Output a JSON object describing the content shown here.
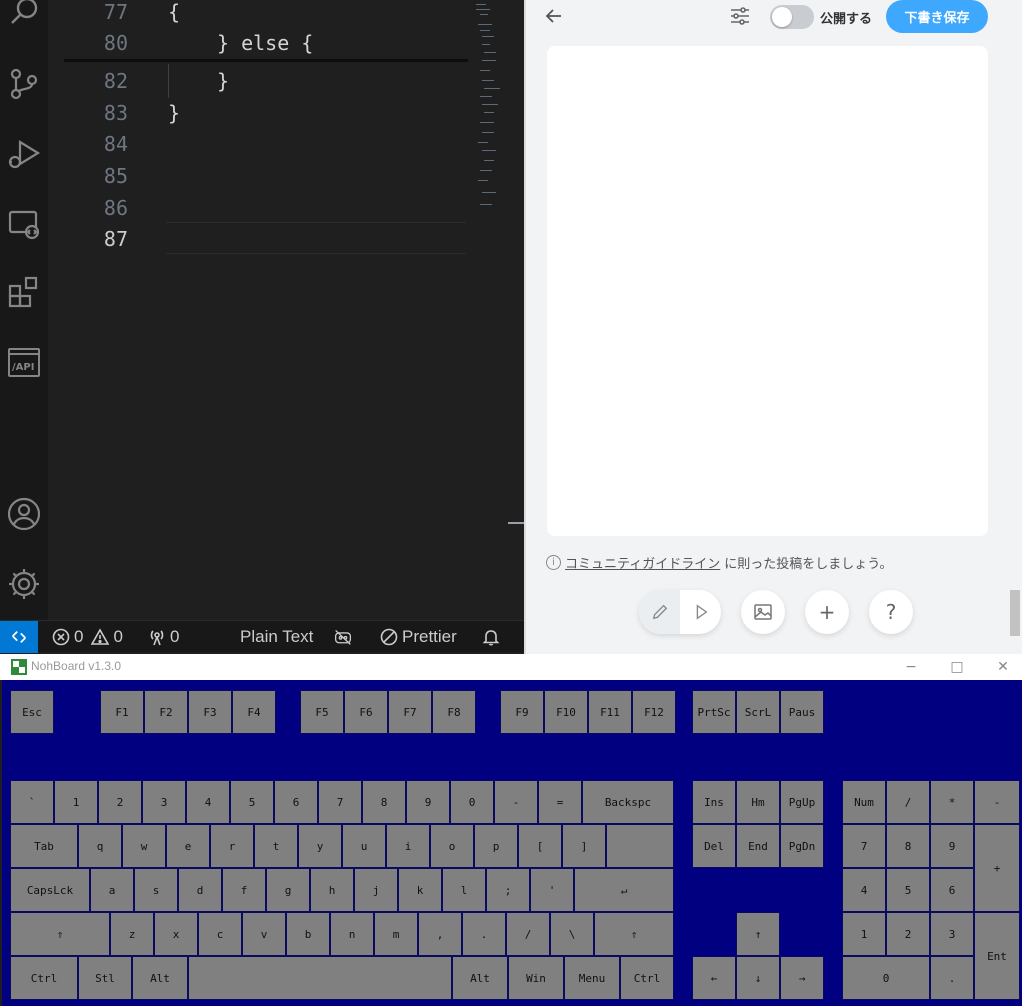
{
  "editor": {
    "gutter": [
      "77",
      "80",
      "82",
      "83",
      "84",
      "85",
      "86",
      "87"
    ],
    "code": [
      "{",
      "} else {",
      "}",
      "}"
    ]
  },
  "statusbar": {
    "errors": "0",
    "warnings": "0",
    "ports": "0",
    "language": "Plain Text",
    "formatter": "Prettier"
  },
  "web": {
    "publish_label": "公開する",
    "save_label": "下書き保存",
    "guideline_link": "コミュニティガイドライン",
    "guideline_rest": "に則った投稿をしましょう。",
    "info_icon": "i",
    "plus": "+",
    "help": "?"
  },
  "nohboard": {
    "title": "NohBoard v1.3.0",
    "minimize": "−",
    "maximize": "□",
    "close": "✕",
    "keys": {
      "esc": "Esc",
      "f1": "F1",
      "f2": "F2",
      "f3": "F3",
      "f4": "F4",
      "f5": "F5",
      "f6": "F6",
      "f7": "F7",
      "f8": "F8",
      "f9": "F9",
      "f10": "F10",
      "f11": "F11",
      "f12": "F12",
      "prtsc": "PrtSc",
      "scrl": "ScrL",
      "paus": "Paus",
      "backtick": "`",
      "k1": "1",
      "k2": "2",
      "k3": "3",
      "k4": "4",
      "k5": "5",
      "k6": "6",
      "k7": "7",
      "k8": "8",
      "k9": "9",
      "k0": "0",
      "minus": "-",
      "equals": "=",
      "backspace": "Backspc",
      "ins": "Ins",
      "hm": "Hm",
      "pgup": "PgUp",
      "num": "Num",
      "numdiv": "/",
      "nummul": "*",
      "numsub": "-",
      "tab": "Tab",
      "q": "q",
      "w": "w",
      "e": "e",
      "r": "r",
      "t": "t",
      "y": "y",
      "u": "u",
      "i": "i",
      "o": "o",
      "p": "p",
      "lbracket": "[",
      "rbracket": "]",
      "del": "Del",
      "end": "End",
      "pgdn": "PgDn",
      "n7": "7",
      "n8": "8",
      "n9": "9",
      "numadd": "+",
      "capslock": "CapsLck",
      "a": "a",
      "s": "s",
      "d": "d",
      "f": "f",
      "g": "g",
      "h": "h",
      "j": "j",
      "k": "k",
      "l": "l",
      "semicolon": ";",
      "quote": "'",
      "enter": "↵",
      "n4": "4",
      "n5": "5",
      "n6": "6",
      "lshift": "⇑",
      "z": "z",
      "x": "x",
      "c": "c",
      "v": "v",
      "b": "b",
      "n": "n",
      "m": "m",
      "comma": ",",
      "period": ".",
      "slash": "/",
      "backslash": "\\",
      "rshift": "⇑",
      "up": "↑",
      "n1": "1",
      "n2": "2",
      "n3": "3",
      "numenter": "Ent",
      "lctrl": "Ctrl",
      "stl": "Stl",
      "lalt": "Alt",
      "space": "",
      "ralt": "Alt",
      "win": "Win",
      "menu": "Menu",
      "rctrl": "Ctrl",
      "left": "←",
      "down": "↓",
      "right": "→",
      "n0": "0",
      "numdot": "."
    }
  },
  "colors": {
    "accent_blue": "#0078d4",
    "save_button": "#3ea8ff",
    "nohboard_bg": "#000080",
    "key_bg": "#808080"
  }
}
